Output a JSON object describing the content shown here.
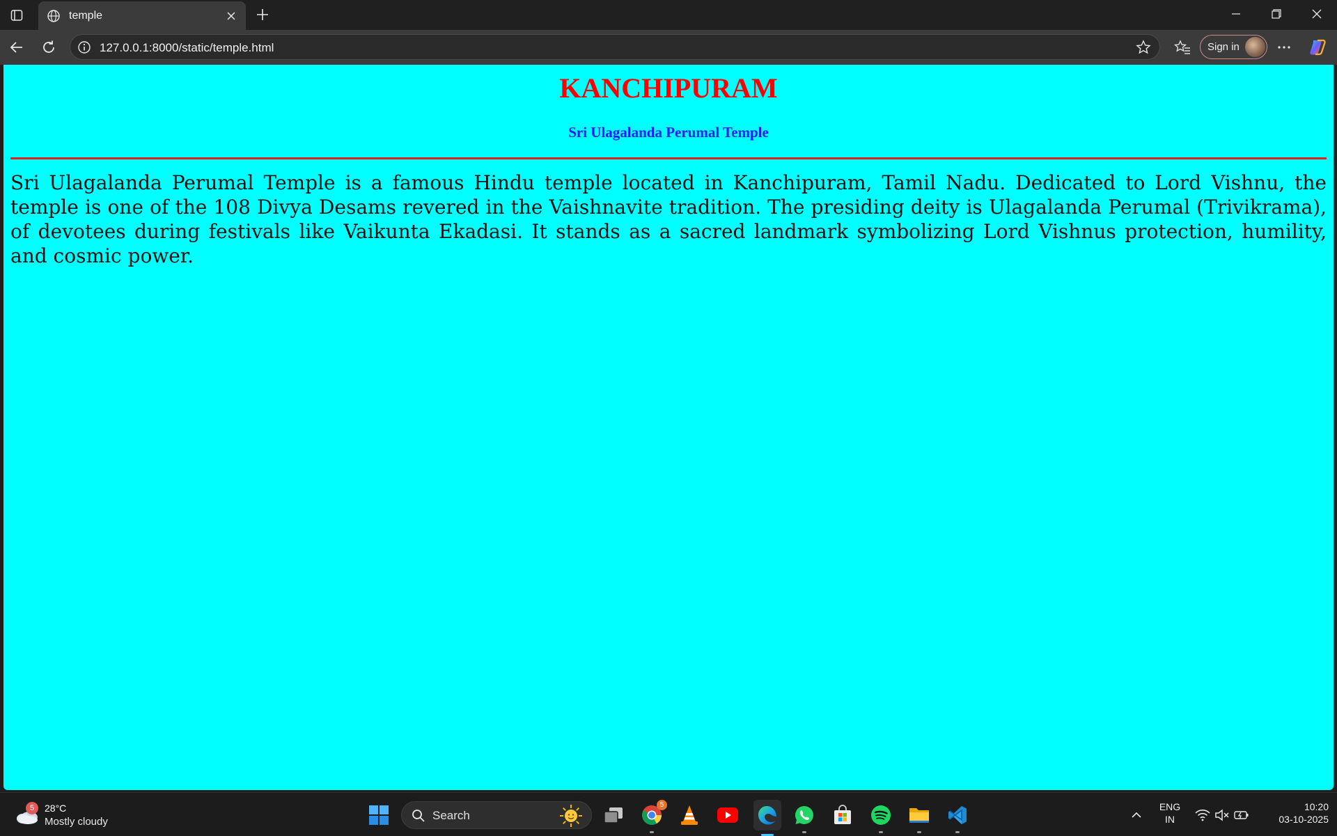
{
  "browser": {
    "tab_title": "temple",
    "url": "127.0.0.1:8000/static/temple.html",
    "signin_label": "Sign in"
  },
  "page": {
    "heading": "KANCHIPURAM",
    "subheading": "Sri Ulagalanda Perumal Temple",
    "paragraph": "Sri Ulagalanda Perumal Temple is a famous Hindu temple located in Kanchipuram, Tamil Nadu. Dedicated to Lord Vishnu, the temple is one of the 108 Divya Desams revered in the Vaishnavite tradition. The presiding deity is Ulagalanda Perumal (Trivikrama), of devotees during festivals like Vaikunta Ekadasi. It stands as a sacred landmark symbolizing Lord Vishnus protection, humility, and cosmic power.",
    "colors": {
      "background": "#00ffff",
      "heading": "#ff0000",
      "subheading": "#1a1aff",
      "rule": "#e0201f"
    }
  },
  "taskbar": {
    "weather_badge": "5",
    "weather_temp": "28°C",
    "weather_condition": "Mostly cloudy",
    "search_label": "Search",
    "chrome_badge": "5",
    "language": "ENG",
    "region": "IN",
    "time": "10:20",
    "date": "03-10-2025",
    "apps": [
      "windows-start-icon",
      "task-view-icon",
      "chrome-icon",
      "vlc-icon",
      "youtube-icon",
      "edge-icon",
      "whatsapp-icon",
      "microsoft-store-icon",
      "spotify-icon",
      "file-explorer-icon",
      "vscode-icon"
    ]
  }
}
